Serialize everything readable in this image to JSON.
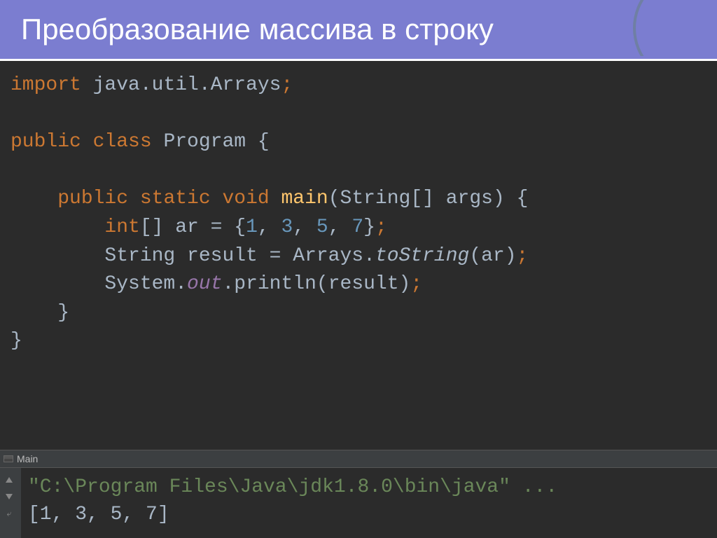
{
  "header": {
    "title": "Преобразование массива в строку"
  },
  "code": {
    "line1_import": "import",
    "line1_package": " java.util.Arrays",
    "line1_semi": ";",
    "line3_public": "public ",
    "line3_class": "class ",
    "line3_name": "Program ",
    "line3_brace": "{",
    "line5_indent": "    ",
    "line5_public": "public ",
    "line5_static": "static ",
    "line5_void": "void ",
    "line5_main": "main",
    "line5_paren_open": "(",
    "line5_string": "String",
    "line5_brackets": "[] args",
    "line5_paren_close": ") ",
    "line5_brace": "{",
    "line6_indent": "        ",
    "line6_int": "int",
    "line6_brackets": "[] ar = {",
    "line6_n1": "1",
    "line6_c1": ", ",
    "line6_n2": "3",
    "line6_c2": ", ",
    "line6_n3": "5",
    "line6_c3": ", ",
    "line6_n4": "7",
    "line6_close": "}",
    "line6_semi": ";",
    "line7_indent": "        ",
    "line7_text": "String result = Arrays.",
    "line7_method": "toString",
    "line7_args": "(ar)",
    "line7_semi": ";",
    "line8_indent": "        ",
    "line8_text1": "System.",
    "line8_out": "out",
    "line8_text2": ".println(result)",
    "line8_semi": ";",
    "line9_indent": "    ",
    "line9_brace": "}",
    "line10_brace": "}"
  },
  "tab": {
    "label": "Main"
  },
  "console": {
    "command": "\"C:\\Program Files\\Java\\jdk1.8.0\\bin\\java\" ...",
    "output": "[1, 3, 5, 7]"
  }
}
